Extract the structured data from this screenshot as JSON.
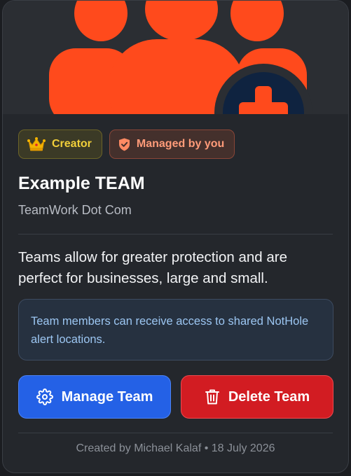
{
  "badges": {
    "creator": {
      "icon": "crown-icon",
      "label": "Creator"
    },
    "managed": {
      "icon": "shield-check-icon",
      "label": "Managed by you"
    }
  },
  "team": {
    "name": "Example TEAM",
    "domain": "TeamWork Dot Com",
    "description": "Teams allow for greater protection and are perfect for businesses, large and small.",
    "info": "Team members can receive access to shared NotHole alert locations."
  },
  "actions": {
    "manage": {
      "icon": "gear-icon",
      "label": "Manage Team"
    },
    "delete": {
      "icon": "trash-icon",
      "label": "Delete Team"
    }
  },
  "footer": "Created by Michael Kalaf • 18 July 2026",
  "colors": {
    "accent_orange": "#ff4a1c",
    "primary_blue": "#2461e6",
    "danger_red": "#d21c22",
    "card_bg": "#24272c"
  }
}
